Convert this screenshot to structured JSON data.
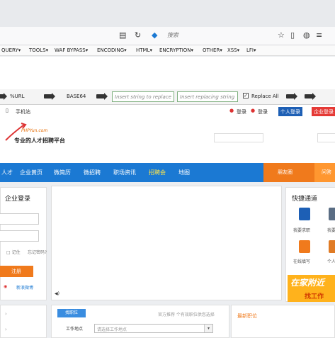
{
  "browser": {
    "search_placeholder": "搜索"
  },
  "hackbar_menu": {
    "items": [
      "QUERY▾",
      "TOOLS▾",
      "WAF BYPASS▾",
      "ENCODING▾",
      "HTML▾",
      "ENCRYPTION▾",
      "OTHER▾",
      "XSS▾",
      "LFI▾"
    ]
  },
  "hackbar_tools": {
    "url_label": "%URL",
    "base64_label": "BASE64",
    "replace_placeholder": "Insert string to replace",
    "replacing_placeholder": "Insert replacing string",
    "replace_all_label": "Replace All",
    "replace_all_checked": true
  },
  "site": {
    "mobile_label": "手机站",
    "login_label": "登录",
    "personal_login": "登录",
    "personal_btn": "个人登录",
    "company_btn": "企业登录",
    "logo_url": "PHPYun.com",
    "slogan": "专业的人才招聘平台",
    "nav": [
      "人才",
      "企业黄页",
      "微简历",
      "微招聘",
      "职场资讯",
      "招聘会",
      "地图"
    ],
    "nav_selected_index": 5,
    "nav_right": [
      "朋友圈",
      "问答"
    ],
    "login_title": "企业登录",
    "login_button": "注册",
    "quick_title": "快捷通道",
    "quick_items": [
      "我要求职",
      "我要招聘",
      "在线填写",
      "个人档案"
    ],
    "ad_title": "在家附近",
    "ad_sub": "找工作",
    "job_tab": "找职位",
    "job_location_label": "工作地点",
    "job_location_placeholder": "请选择工作地点",
    "latest_jobs": "最新职位",
    "job_hint": "官方推荐 个有效职位供您选择"
  },
  "colors": {
    "nav_blue": "#1b79d3",
    "orange": "#f07a1c",
    "ad_yellow": "#ffb21c",
    "personal_btn": "#1d5fb5",
    "company_btn": "#e53935"
  }
}
